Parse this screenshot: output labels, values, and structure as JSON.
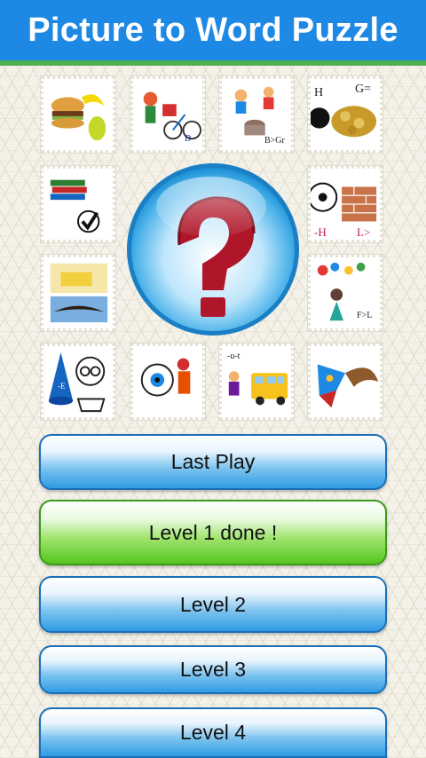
{
  "header": {
    "title": "Picture to Word Puzzle"
  },
  "hero": {
    "icon": "question-mark-icon"
  },
  "stamps": [
    {
      "id": "food",
      "icon": "burger-banana-pear-icon"
    },
    {
      "id": "cyclist",
      "icon": "cyclist-icon",
      "text": "D"
    },
    {
      "id": "drummer",
      "icon": "drummer-icon",
      "text": "B>Gr"
    },
    {
      "id": "gold",
      "icon": "gold-coins-icon",
      "text_left": "H",
      "text_right": "G="
    },
    {
      "id": "books",
      "icon": "books-checkmark-icon"
    },
    {
      "id": "ball-wall",
      "icon": "ball-brick-wall-icon",
      "text_left": "-H",
      "text_right": "L>"
    },
    {
      "id": "butter-eagle",
      "icon": "butter-eagle-icon"
    },
    {
      "id": "girl",
      "icon": "girl-flowers-icon",
      "text": "F>L"
    },
    {
      "id": "cone",
      "icon": "cone-nerd-icon",
      "text": "-E"
    },
    {
      "id": "eye",
      "icon": "eye-man-icon"
    },
    {
      "id": "bus",
      "icon": "bus-icon",
      "text": "-u-t"
    },
    {
      "id": "dragon",
      "icon": "dragon-icon"
    }
  ],
  "buttons": [
    {
      "label": "Last Play"
    },
    {
      "label": "Level 1 done !"
    },
    {
      "label": "Level 2"
    },
    {
      "label": "Level 3"
    },
    {
      "label": "Level 4"
    }
  ],
  "colors": {
    "header": "#1e88e5",
    "header_border": "#4caf50",
    "button_blue": "#2f9be3",
    "button_green": "#55c61e"
  }
}
